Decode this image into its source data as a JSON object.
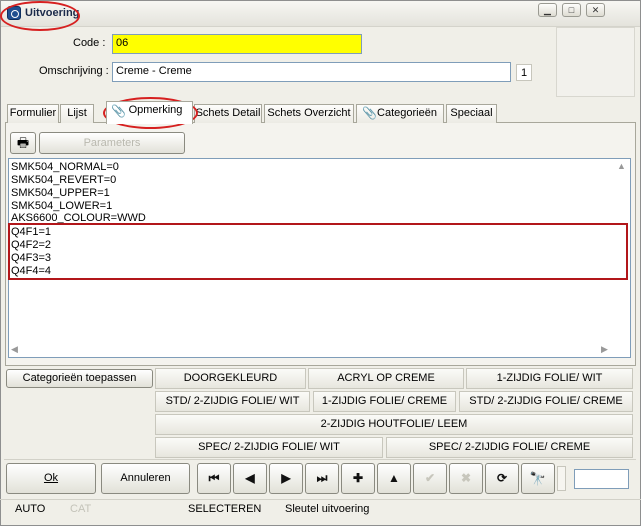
{
  "window": {
    "title": "Uitvoering"
  },
  "form": {
    "code_label": "Code :",
    "code_value": "06",
    "omschrijving_label": "Omschrijving :",
    "omschrijving_value": "Creme - Creme",
    "counter": "1"
  },
  "tabs": [
    "Formulier",
    "Lijst",
    "Opmerking",
    "Schets Detail",
    "Schets Overzicht",
    "Categorieën",
    "Speciaal"
  ],
  "toolbar": {
    "parameters_label": "Parameters"
  },
  "memo": {
    "lines": [
      "SMK504_NORMAL=0",
      "SMK504_REVERT=0",
      "SMK504_UPPER=1",
      "SMK504_LOWER=1",
      "AKS6600_COLOUR=WWD",
      "Q4F1=1",
      "Q4F2=2",
      "Q4F3=3",
      "Q4F4=4"
    ]
  },
  "categories": {
    "apply_label": "Categorieën toepassen",
    "buttons": [
      "DOORGEKLEURD",
      "ACRYL OP CREME",
      "1-ZIJDIG FOLIE/ WIT",
      "STD/ 2-ZIJDIG FOLIE/ WIT",
      "1-ZIJDIG FOLIE/ CREME",
      "STD/ 2-ZIJDIG FOLIE/ CREME",
      "2-ZIJDIG HOUTFOLIE/ LEEM",
      "SPEC/ 2-ZIJDIG FOLIE/ WIT",
      "SPEC/ 2-ZIJDIG FOLIE/ CREME"
    ]
  },
  "footer": {
    "ok_label": "Ok",
    "cancel_label": "Annuleren",
    "nav_icons": {
      "first": "⏮",
      "prev": "◀",
      "next": "▶",
      "last": "⏭",
      "add": "✚",
      "up": "▲",
      "confirm": "✔",
      "delete": "✖",
      "refresh": "⟳",
      "search": "🔭"
    }
  },
  "statusbar": {
    "auto": "AUTO",
    "cat": "CAT",
    "selecteren": "SELECTEREN",
    "sleutel": "Sleutel uitvoering"
  },
  "colors": {
    "code_field_bg": "#ffff00",
    "highlight": "#b2161a",
    "annotation": "#d62020"
  }
}
